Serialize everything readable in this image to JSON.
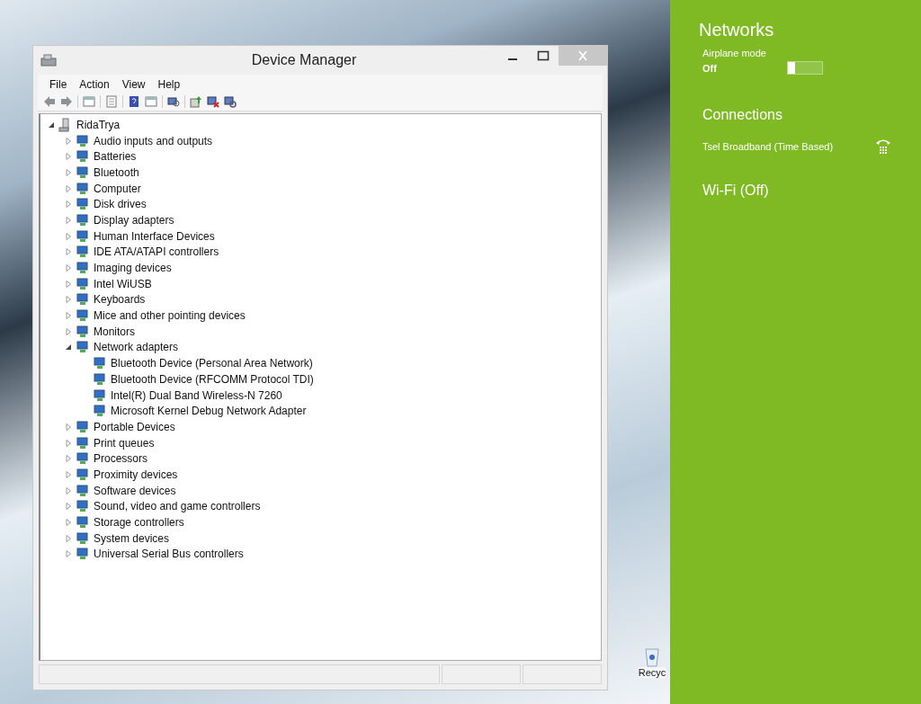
{
  "window": {
    "title": "Device Manager"
  },
  "menu": [
    "File",
    "Action",
    "View",
    "Help"
  ],
  "tree": {
    "label": "RidaTrya",
    "expanded": true,
    "children": [
      {
        "label": "Audio inputs and outputs",
        "expanded": false
      },
      {
        "label": "Batteries",
        "expanded": false
      },
      {
        "label": "Bluetooth",
        "expanded": false
      },
      {
        "label": "Computer",
        "expanded": false
      },
      {
        "label": "Disk drives",
        "expanded": false
      },
      {
        "label": "Display adapters",
        "expanded": false
      },
      {
        "label": "Human Interface Devices",
        "expanded": false
      },
      {
        "label": "IDE ATA/ATAPI controllers",
        "expanded": false
      },
      {
        "label": "Imaging devices",
        "expanded": false
      },
      {
        "label": "Intel WiUSB",
        "expanded": false
      },
      {
        "label": "Keyboards",
        "expanded": false
      },
      {
        "label": "Mice and other pointing devices",
        "expanded": false
      },
      {
        "label": "Monitors",
        "expanded": false
      },
      {
        "label": "Network adapters",
        "expanded": true,
        "children": [
          {
            "label": "Bluetooth Device (Personal Area Network)"
          },
          {
            "label": "Bluetooth Device (RFCOMM Protocol TDI)"
          },
          {
            "label": "Intel(R) Dual Band Wireless-N 7260"
          },
          {
            "label": "Microsoft Kernel Debug Network Adapter"
          }
        ]
      },
      {
        "label": "Portable Devices",
        "expanded": false
      },
      {
        "label": "Print queues",
        "expanded": false
      },
      {
        "label": "Processors",
        "expanded": false
      },
      {
        "label": "Proximity devices",
        "expanded": false
      },
      {
        "label": "Software devices",
        "expanded": false
      },
      {
        "label": "Sound, video and game controllers",
        "expanded": false
      },
      {
        "label": "Storage controllers",
        "expanded": false
      },
      {
        "label": "System devices",
        "expanded": false
      },
      {
        "label": "Universal Serial Bus controllers",
        "expanded": false
      }
    ]
  },
  "desktop": {
    "icon_label": "Recyc"
  },
  "networks_panel": {
    "title": "Networks",
    "airplane_mode": {
      "label": "Airplane mode",
      "state_text": "Off",
      "on": false
    },
    "connections_heading": "Connections",
    "connections": [
      {
        "name": "Tsel Broadband (Time Based)"
      }
    ],
    "wifi": "Wi-Fi (Off)"
  }
}
